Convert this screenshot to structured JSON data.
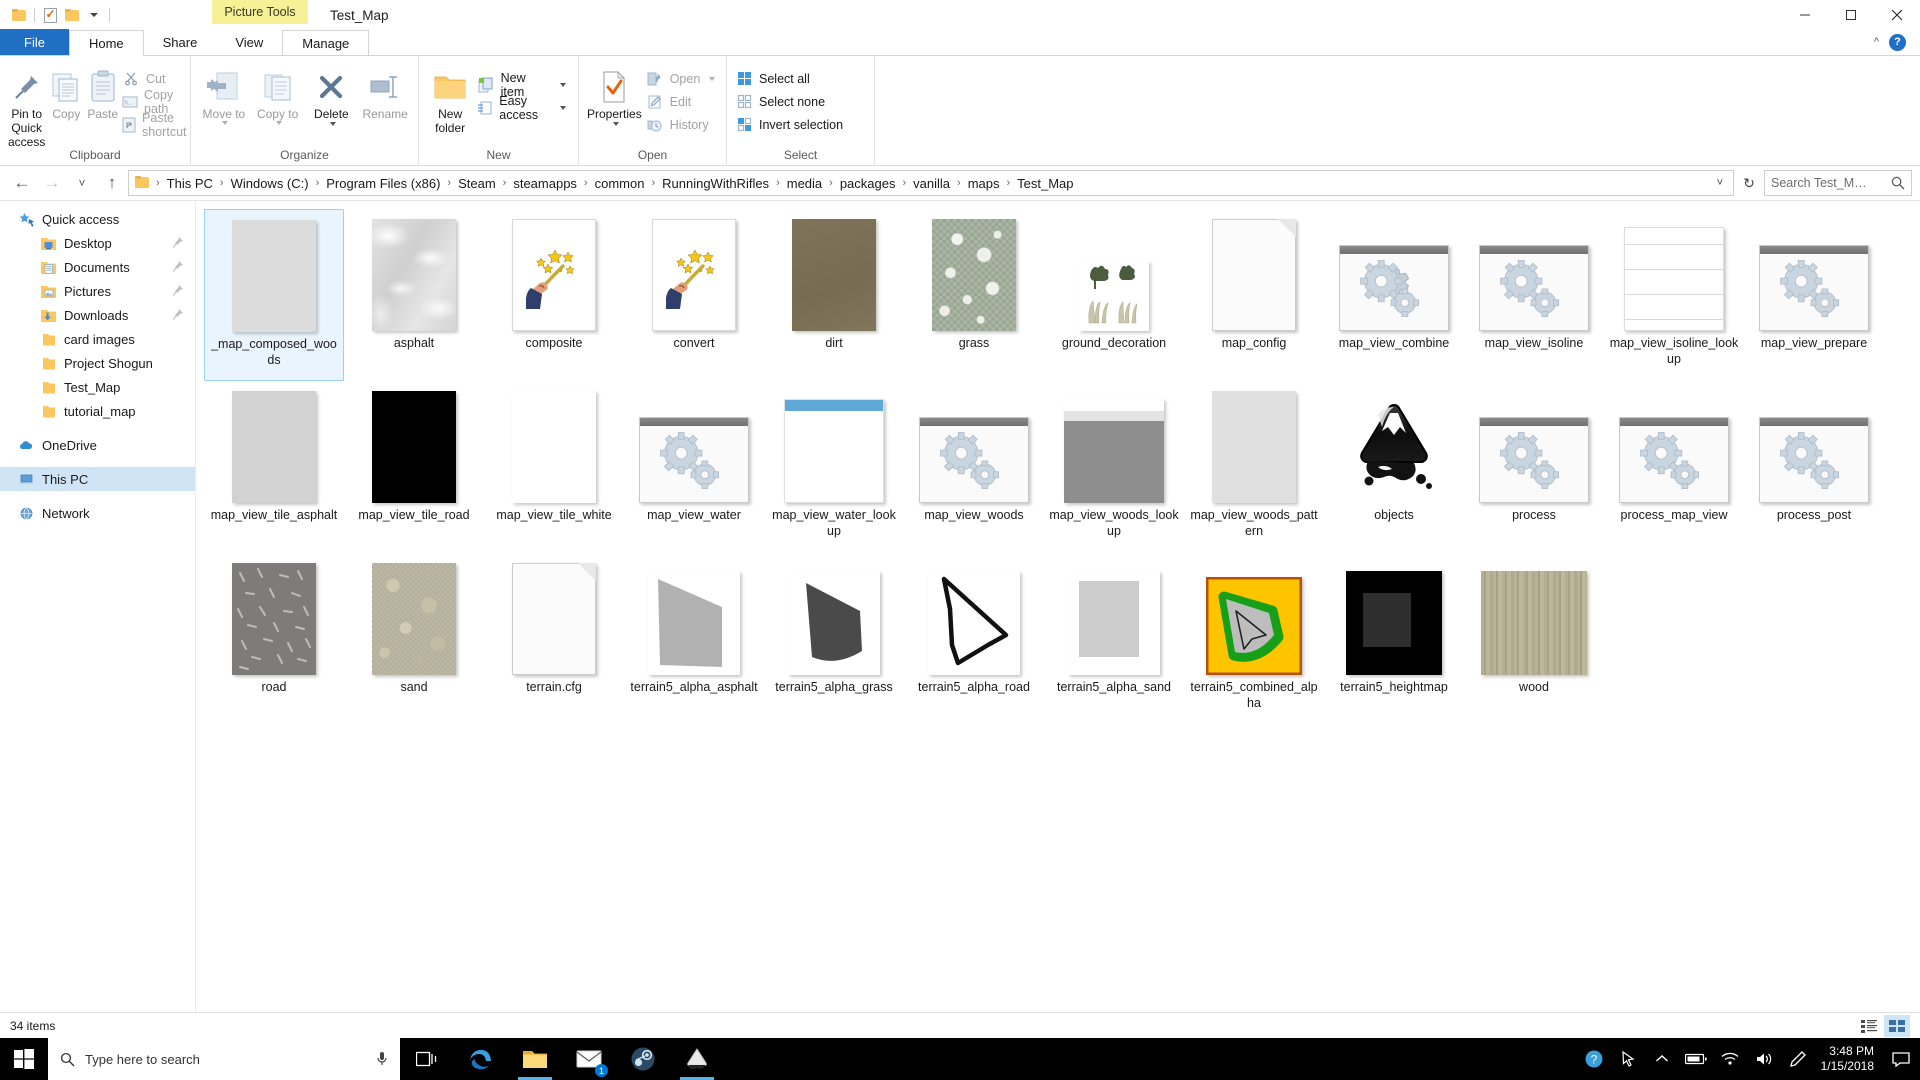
{
  "titlebar": {
    "quick_access_icons": [
      "folder-icon",
      "properties-icon",
      "new-folder-icon",
      "customize-chevron-icon"
    ],
    "contextual_tab_group": "Picture Tools",
    "window_title": "Test_Map",
    "controls": [
      "minimize",
      "maximize",
      "close"
    ]
  },
  "tabs": [
    {
      "label": "File",
      "state": "file"
    },
    {
      "label": "Home",
      "state": "active"
    },
    {
      "label": "Share",
      "state": "normal"
    },
    {
      "label": "View",
      "state": "normal"
    },
    {
      "label": "Manage",
      "state": "contextual"
    }
  ],
  "ribbon": {
    "collapse_label": "^",
    "help_label": "?",
    "groups": [
      {
        "label": "Clipboard",
        "big": [
          {
            "label": "Pin to Quick access",
            "icon": "pin-icon",
            "dim": false
          },
          {
            "label": "Copy",
            "icon": "copy-icon",
            "dim": true
          },
          {
            "label": "Paste",
            "icon": "paste-icon",
            "dim": true
          }
        ],
        "small": [
          {
            "label": "Cut",
            "icon": "scissors-icon",
            "dim": true
          },
          {
            "label": "Copy path",
            "icon": "copy-path-icon",
            "dim": true
          },
          {
            "label": "Paste shortcut",
            "icon": "paste-shortcut-icon",
            "dim": true
          }
        ]
      },
      {
        "label": "Organize",
        "big": [
          {
            "label": "Move to",
            "icon": "move-to-icon",
            "dim": true,
            "split": true
          },
          {
            "label": "Copy to",
            "icon": "copy-to-icon",
            "dim": true,
            "split": true
          },
          {
            "label": "Delete",
            "icon": "delete-icon",
            "dim": false,
            "split": true
          },
          {
            "label": "Rename",
            "icon": "rename-icon",
            "dim": true
          }
        ],
        "small": []
      },
      {
        "label": "New",
        "big": [
          {
            "label": "New folder",
            "icon": "new-folder-icon",
            "dim": false
          }
        ],
        "small": [
          {
            "label": "New item",
            "icon": "new-item-icon",
            "dim": false,
            "split": true
          },
          {
            "label": "Easy access",
            "icon": "easy-access-icon",
            "dim": false,
            "split": true
          }
        ]
      },
      {
        "label": "Open",
        "big": [
          {
            "label": "Properties",
            "icon": "properties-icon",
            "dim": false,
            "split": true
          }
        ],
        "small": [
          {
            "label": "Open",
            "icon": "open-icon",
            "dim": true,
            "split": true
          },
          {
            "label": "Edit",
            "icon": "edit-icon",
            "dim": true
          },
          {
            "label": "History",
            "icon": "history-icon",
            "dim": true
          }
        ]
      },
      {
        "label": "Select",
        "big": [],
        "small": [
          {
            "label": "Select all",
            "icon": "select-all-icon",
            "dim": false
          },
          {
            "label": "Select none",
            "icon": "select-none-icon",
            "dim": false
          },
          {
            "label": "Invert selection",
            "icon": "invert-selection-icon",
            "dim": false
          }
        ]
      }
    ]
  },
  "address": {
    "back": "←",
    "forward": "→",
    "recent": "˅",
    "up": "↑",
    "breadcrumbs": [
      "This PC",
      "Windows (C:)",
      "Program Files (x86)",
      "Steam",
      "steamapps",
      "common",
      "RunningWithRifles",
      "media",
      "packages",
      "vanilla",
      "maps",
      "Test_Map"
    ],
    "separator": "›",
    "dropdown_chevron": "˅",
    "refresh": "↻"
  },
  "search": {
    "placeholder": "Search Test_M…",
    "value": "",
    "icon": "search-icon"
  },
  "nav_pane": [
    {
      "label": "Quick access",
      "icon": "star-pin-icon",
      "level": "root",
      "pinned": false,
      "selected": false
    },
    {
      "label": "Desktop",
      "icon": "desktop-folder-icon",
      "level": "child",
      "pinned": true,
      "selected": false
    },
    {
      "label": "Documents",
      "icon": "documents-folder-icon",
      "level": "child",
      "pinned": true,
      "selected": false
    },
    {
      "label": "Pictures",
      "icon": "pictures-folder-icon",
      "level": "child",
      "pinned": true,
      "selected": false
    },
    {
      "label": "Downloads",
      "icon": "downloads-folder-icon",
      "level": "child",
      "pinned": true,
      "selected": false
    },
    {
      "label": "card images",
      "icon": "folder-icon",
      "level": "child",
      "pinned": false,
      "selected": false
    },
    {
      "label": "Project Shogun",
      "icon": "folder-icon",
      "level": "child",
      "pinned": false,
      "selected": false
    },
    {
      "label": "Test_Map",
      "icon": "folder-icon",
      "level": "child",
      "pinned": false,
      "selected": false
    },
    {
      "label": "tutorial_map",
      "icon": "folder-icon",
      "level": "child",
      "pinned": false,
      "selected": false
    },
    {
      "label": "OneDrive",
      "icon": "onedrive-cloud-icon",
      "level": "root",
      "pinned": false,
      "selected": false
    },
    {
      "label": "This PC",
      "icon": "this-pc-icon",
      "level": "root",
      "pinned": false,
      "selected": true
    },
    {
      "label": "Network",
      "icon": "network-icon",
      "level": "root",
      "pinned": false,
      "selected": false
    }
  ],
  "files": [
    {
      "name": "_map_composed_woods",
      "thumb": "image-flat",
      "color": "#dcdcdc",
      "selected": true
    },
    {
      "name": "asphalt",
      "thumb": "texture-asphalt",
      "color": "#d8d8d8",
      "selected": false
    },
    {
      "name": "composite",
      "thumb": "wand-script",
      "color": "#ffffff",
      "selected": false
    },
    {
      "name": "convert",
      "thumb": "wand-script",
      "color": "#ffffff",
      "selected": false
    },
    {
      "name": "dirt",
      "thumb": "image-flat",
      "color": "#7e7358",
      "selected": false
    },
    {
      "name": "grass",
      "thumb": "texture-grass",
      "color": "#9aa694",
      "selected": false
    },
    {
      "name": "ground_decoration",
      "thumb": "plants",
      "color": "#ffffff",
      "selected": false
    },
    {
      "name": "map_config",
      "thumb": "paper",
      "color": "#fbfbfb",
      "selected": false
    },
    {
      "name": "map_view_combine",
      "thumb": "app-gears",
      "color": "#fafafa",
      "selected": false
    },
    {
      "name": "map_view_isoline",
      "thumb": "app-gears",
      "color": "#fafafa",
      "selected": false
    },
    {
      "name": "map_view_isoline_lookup",
      "thumb": "lines-doc",
      "color": "#ffffff",
      "selected": false
    },
    {
      "name": "map_view_prepare",
      "thumb": "app-gears",
      "color": "#fafafa",
      "selected": false
    },
    {
      "name": "map_view_tile_asphalt",
      "thumb": "image-flat",
      "color": "#d2d2d2",
      "selected": false
    },
    {
      "name": "map_view_tile_road",
      "thumb": "image-flat",
      "color": "#000000",
      "selected": false
    },
    {
      "name": "map_view_tile_white",
      "thumb": "image-flat",
      "color": "#ffffff",
      "selected": false
    },
    {
      "name": "map_view_water",
      "thumb": "app-gears",
      "color": "#fafafa",
      "selected": false
    },
    {
      "name": "map_view_water_lookup",
      "thumb": "band-top",
      "color": "#5fa8d8",
      "selected": false
    },
    {
      "name": "map_view_woods",
      "thumb": "app-gears",
      "color": "#fafafa",
      "selected": false
    },
    {
      "name": "map_view_woods_lookup",
      "thumb": "band-woods",
      "color": "#8e8e8e",
      "selected": false
    },
    {
      "name": "map_view_woods_pattern",
      "thumb": "image-flat",
      "color": "#e0e0e0",
      "selected": false
    },
    {
      "name": "objects",
      "thumb": "inkscape",
      "color": "#111111",
      "selected": false
    },
    {
      "name": "process",
      "thumb": "app-gears",
      "color": "#fafafa",
      "selected": false
    },
    {
      "name": "process_map_view",
      "thumb": "app-gears",
      "color": "#fafafa",
      "selected": false
    },
    {
      "name": "process_post",
      "thumb": "app-gears",
      "color": "#fafafa",
      "selected": false
    },
    {
      "name": "road",
      "thumb": "texture-road",
      "color": "#7d7c78",
      "selected": false
    },
    {
      "name": "sand",
      "thumb": "texture-sand",
      "color": "#b4af9c",
      "selected": false
    },
    {
      "name": "terrain.cfg",
      "thumb": "paper",
      "color": "#fbfbfb",
      "selected": false
    },
    {
      "name": "terrain5_alpha_asphalt",
      "thumb": "alpha-asphalt",
      "color": "#b1b1b1",
      "selected": false
    },
    {
      "name": "terrain5_alpha_grass",
      "thumb": "alpha-grass",
      "color": "#4a4a4a",
      "selected": false
    },
    {
      "name": "terrain5_alpha_road",
      "thumb": "alpha-road",
      "color": "#111111",
      "selected": false
    },
    {
      "name": "terrain5_alpha_sand",
      "thumb": "alpha-sand",
      "color": "#cccccc",
      "selected": false
    },
    {
      "name": "terrain5_combined_alpha",
      "thumb": "combined-alpha",
      "color": "#ffc400",
      "selected": false
    },
    {
      "name": "terrain5_heightmap",
      "thumb": "heightmap",
      "color": "#000000",
      "selected": false
    },
    {
      "name": "wood",
      "thumb": "texture-wood",
      "color": "#b0ab91",
      "selected": false
    }
  ],
  "statusbar": {
    "item_count": "34 items",
    "views": [
      "details-view-icon",
      "large-icons-view-icon"
    ],
    "active_view": "large-icons-view-icon"
  },
  "taskbar": {
    "start": "windows-logo-icon",
    "search_placeholder": "Type here to search",
    "mic_icon": "microphone-icon",
    "task_view": "task-view-icon",
    "apps": [
      {
        "name": "edge-icon",
        "active": false
      },
      {
        "name": "file-explorer-icon",
        "active": true
      },
      {
        "name": "mail-icon",
        "active": false,
        "badge": "1"
      },
      {
        "name": "steam-icon",
        "active": false
      },
      {
        "name": "inkscape-icon",
        "active": true
      }
    ],
    "tray": [
      "help-icon",
      "mouse-pointer-icon",
      "chevron-up-icon",
      "battery-icon",
      "network-icon",
      "volume-icon",
      "pen-icon"
    ],
    "clock_time": "3:48 PM",
    "clock_date": "1/15/2018",
    "action_center": "notification-icon"
  },
  "colors": {
    "accent_blue": "#1f6fc4",
    "selection_blue": "#cfe4f5",
    "contextual_yellow": "#f6f096",
    "taskbar_black": "#000000"
  }
}
